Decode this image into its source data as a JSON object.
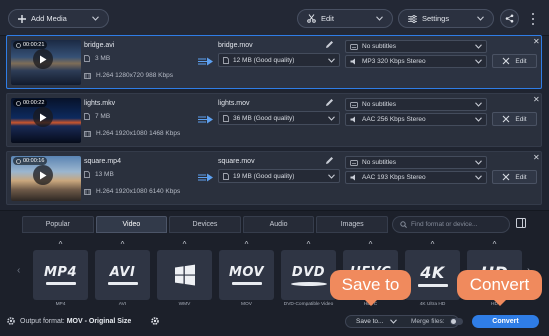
{
  "toolbar": {
    "add_media": "Add Media",
    "edit": "Edit",
    "settings": "Settings"
  },
  "files": [
    {
      "duration": "00:00:21",
      "name": "bridge.avi",
      "size": "3 MB",
      "codec": "H.264 1280x720 988 Kbps",
      "output_name": "bridge.mov",
      "output_size": "12 MB (Good quality)",
      "subtitles": "No subtitles",
      "audio": "MP3 320 Kbps Stereo",
      "edit": "Edit",
      "selected": true
    },
    {
      "duration": "00:00:22",
      "name": "lights.mkv",
      "size": "7 MB",
      "codec": "H.264 1920x1080 1468 Kbps",
      "output_name": "lights.mov",
      "output_size": "36 MB (Good quality)",
      "subtitles": "No subtitles",
      "audio": "AAC 256 Kbps Stereo",
      "edit": "Edit",
      "selected": false
    },
    {
      "duration": "00:00:16",
      "name": "square.mp4",
      "size": "13 MB",
      "codec": "H.264 1920x1080 6140 Kbps",
      "output_name": "square.mov",
      "output_size": "19 MB (Good quality)",
      "subtitles": "No subtitles",
      "audio": "AAC 193 Kbps Stereo",
      "edit": "Edit",
      "selected": false
    }
  ],
  "tabs": [
    "Popular",
    "Video",
    "Devices",
    "Audio",
    "Images"
  ],
  "active_tab": "Video",
  "search": {
    "placeholder": "Find format or device..."
  },
  "formats": [
    {
      "logo": "MP4",
      "caption": "MP4"
    },
    {
      "logo": "AVI",
      "caption": "AVI"
    },
    {
      "logo": "",
      "caption": "WMV"
    },
    {
      "logo": "MOV",
      "caption": "MOV"
    },
    {
      "logo": "DVD",
      "caption": "DVD-Compatible Video"
    },
    {
      "logo": "HEVC",
      "caption": "HEVC"
    },
    {
      "logo": "4K",
      "caption": "4K Ultra HD"
    },
    {
      "logo": "HD",
      "caption": "HD"
    }
  ],
  "footer": {
    "output_format_label": "Output format:",
    "output_format_value": "MOV - Original Size",
    "save_to": "Save to...",
    "merge_files": "Merge files:",
    "convert": "Convert"
  },
  "overlays": {
    "save_to": "Save to",
    "convert": "Convert"
  },
  "colors": {
    "accent": "#2f7de6",
    "overlay": "#f08a5d"
  }
}
